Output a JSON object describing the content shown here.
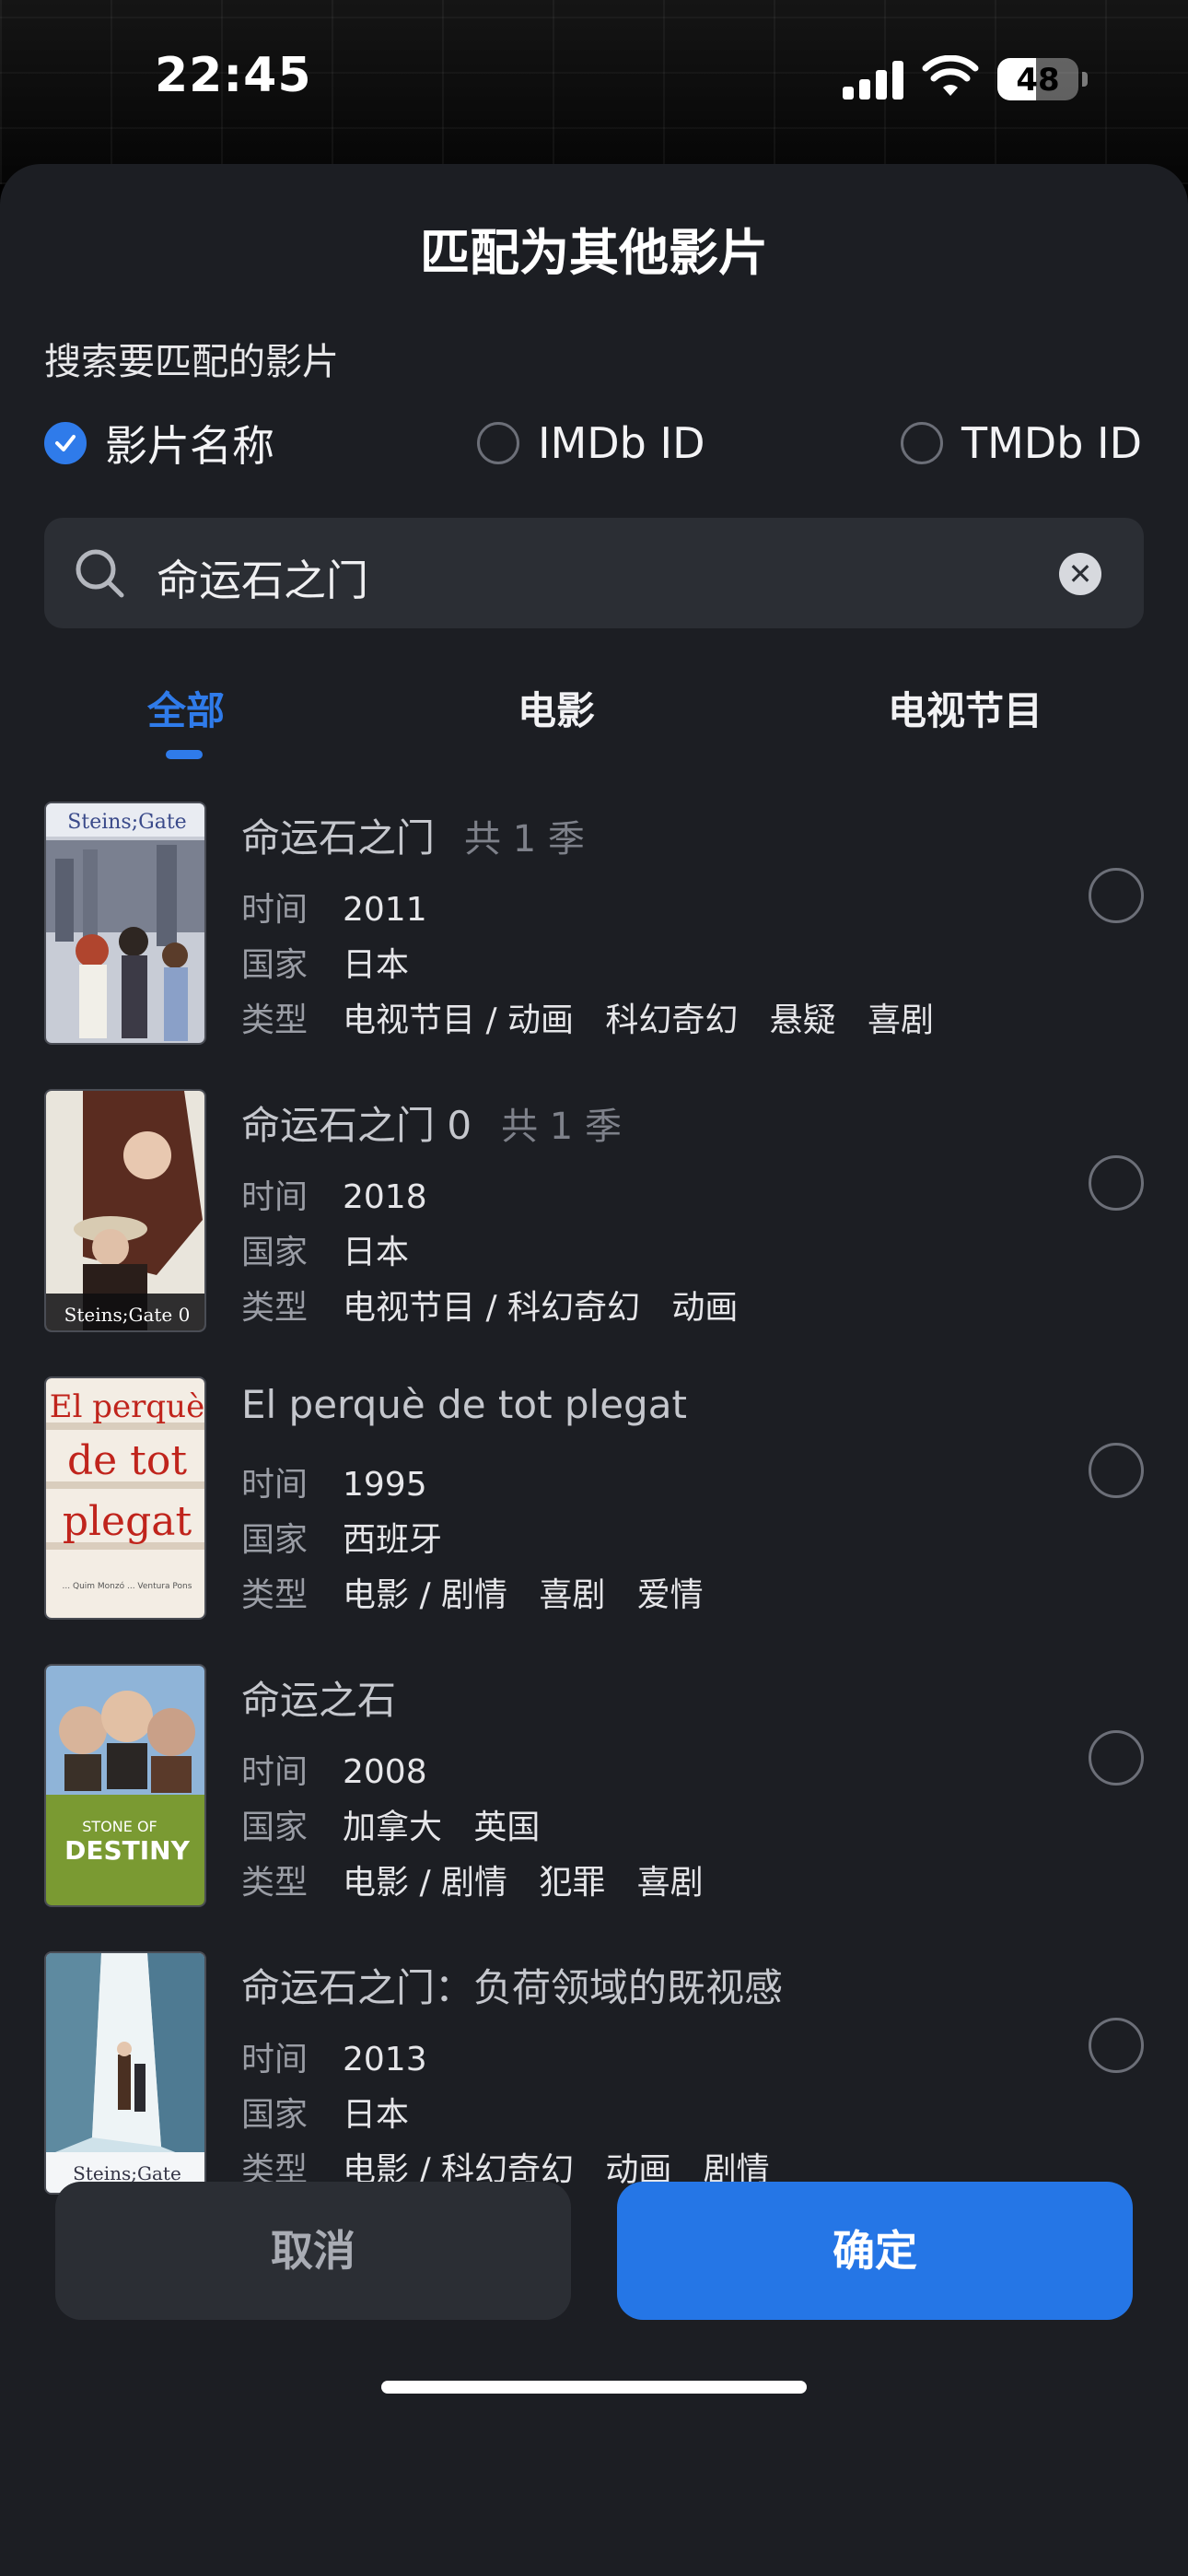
{
  "status": {
    "time": "22:45",
    "battery": "48",
    "battery_level": 0.48
  },
  "dialog": {
    "title": "匹配为其他影片",
    "subtitle": "搜索要匹配的影片",
    "search_types": [
      {
        "label": "影片名称",
        "checked": true
      },
      {
        "label": "IMDb ID",
        "checked": false
      },
      {
        "label": "TMDb ID",
        "checked": false
      }
    ],
    "search_value": "命运石之门",
    "tabs": [
      "全部",
      "电影",
      "电视节目"
    ],
    "active_tab": "全部",
    "field_labels": {
      "time": "时间",
      "country": "国家",
      "genre": "类型"
    },
    "results": [
      {
        "title": "命运石之门",
        "seasons": "共 1 季",
        "year": "2011",
        "country": "日本",
        "genre": "电视节目 / 动画   科幻奇幻   悬疑   喜剧",
        "poster_text": "Steins;Gate"
      },
      {
        "title": "命运石之门 0",
        "seasons": "共 1 季",
        "year": "2018",
        "country": "日本",
        "genre": "电视节目 / 科幻奇幻   动画",
        "poster_text": "Steins;Gate 0"
      },
      {
        "title": "El perquè de tot plegat",
        "seasons": "",
        "year": "1995",
        "country": "西班牙",
        "genre": "电影 / 剧情   喜剧   爱情",
        "poster_text": "El perquè de tot plegat"
      },
      {
        "title": "命运之石",
        "seasons": "",
        "year": "2008",
        "country": "加拿大   英国",
        "genre": "电影 / 剧情   犯罪   喜剧",
        "poster_text": "STONE OF DESTINY"
      },
      {
        "title": "命运石之门：负荷领域的既视感",
        "seasons": "",
        "year": "2013",
        "country": "日本",
        "genre": "电影 / 科幻奇幻   动画   剧情",
        "poster_text": "Steins;Gate"
      }
    ],
    "cancel_label": "取消",
    "confirm_label": "确定"
  },
  "colors": {
    "accent": "#2f7bea",
    "sheet_bg": "#1c1e23",
    "field_bg": "#2b2e34"
  }
}
